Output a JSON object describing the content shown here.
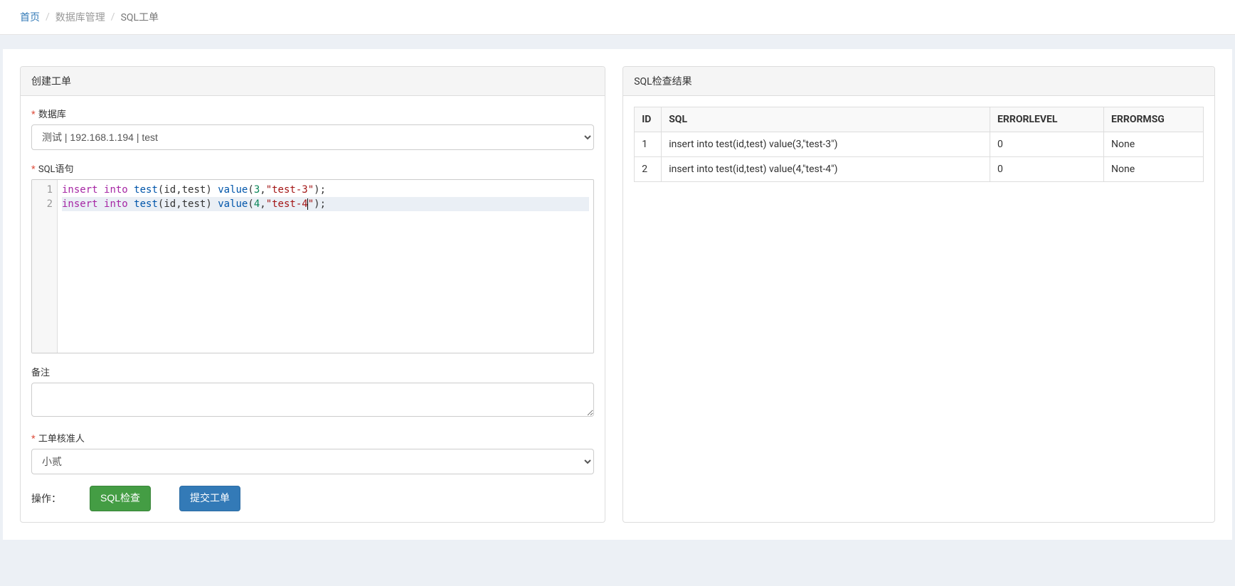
{
  "breadcrumb": {
    "home": "首页",
    "db_mgmt": "数据库管理",
    "current": "SQL工单"
  },
  "left_panel": {
    "title": "创建工单",
    "db_label": "数据库",
    "db_selected": "测试 | 192.168.1.194 | test",
    "sql_label": "SQL语句",
    "sql_lines": [
      "insert into test(id,test) value(3,\"test-3\");",
      "insert into test(id,test) value(4,\"test-4\");"
    ],
    "remark_label": "备注",
    "remark_value": "",
    "approver_label": "工单核准人",
    "approver_selected": "小贰",
    "actions_label": "操作：",
    "btn_check": "SQL检查",
    "btn_submit": "提交工单"
  },
  "right_panel": {
    "title": "SQL检查结果",
    "columns": {
      "id": "ID",
      "sql": "SQL",
      "errorlevel": "ERRORLEVEL",
      "errormsg": "ERRORMSG"
    },
    "rows": [
      {
        "id": "1",
        "sql": "insert into test(id,test) value(3,\"test-3\")",
        "errorlevel": "0",
        "errormsg": "None"
      },
      {
        "id": "2",
        "sql": "insert into test(id,test) value(4,\"test-4\")",
        "errorlevel": "0",
        "errormsg": "None"
      }
    ]
  }
}
